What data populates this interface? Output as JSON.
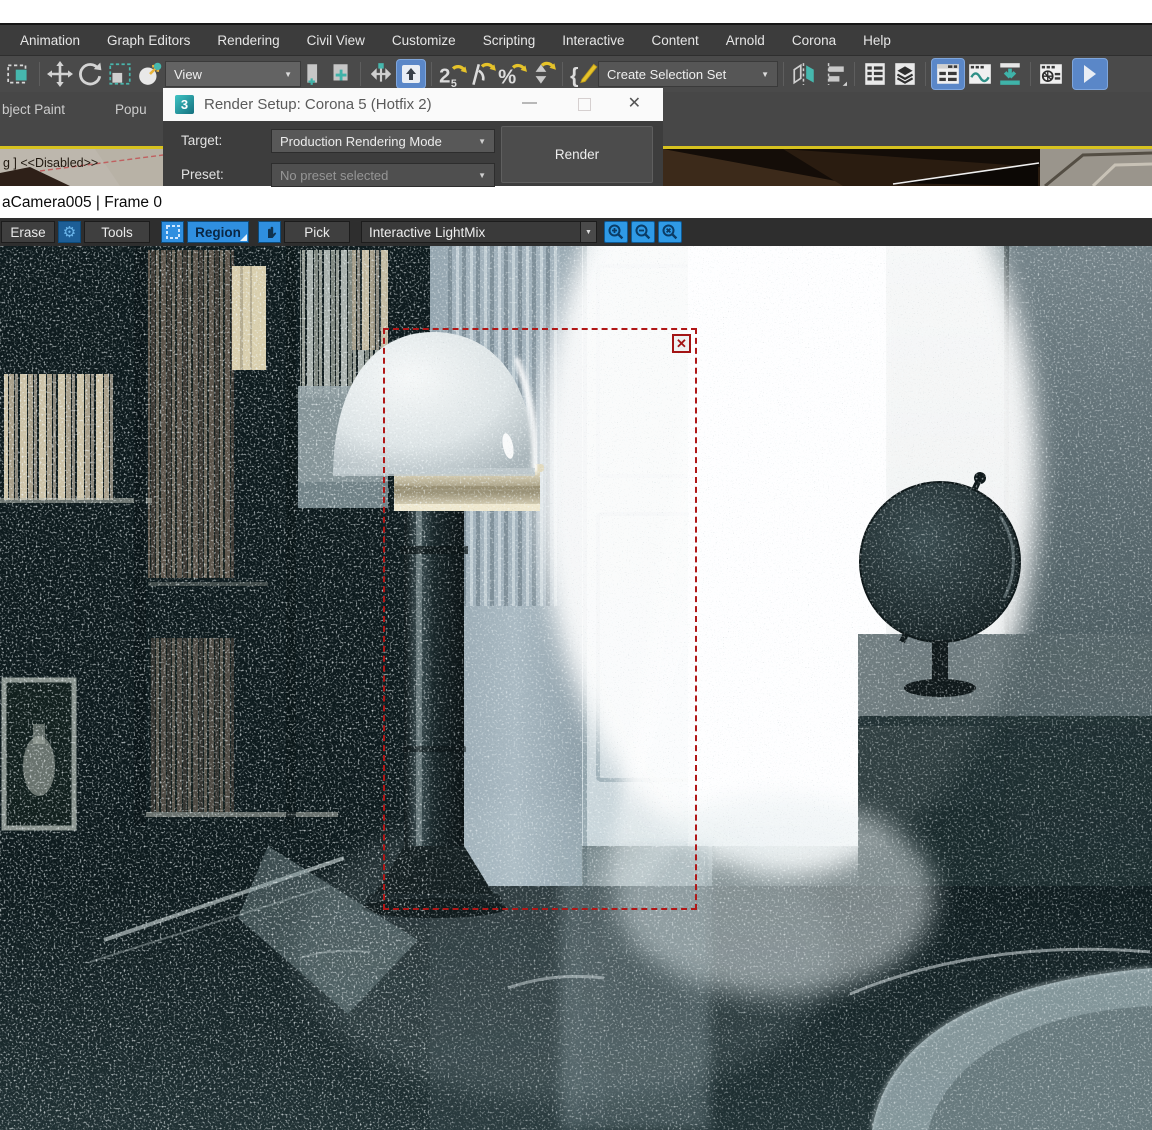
{
  "menubar": {
    "items": [
      "Animation",
      "Graph Editors",
      "Rendering",
      "Civil View",
      "Customize",
      "Scripting",
      "Interactive",
      "Content",
      "Arnold",
      "Corona",
      "Help"
    ]
  },
  "main_toolbar": {
    "view_dropdown": "View",
    "selection_set_dropdown": "Create Selection Set"
  },
  "ribbon": {
    "tab_object_paint": "bject Paint",
    "tab_populate": "Popu"
  },
  "viewport_strip": {
    "label": "g ]  <<Disabled>>"
  },
  "render_setup_dialog": {
    "title": "Render Setup: Corona 5 (Hotfix 2)",
    "logo": "3",
    "target_label": "Target:",
    "target_value": "Production Rendering Mode",
    "preset_label": "Preset:",
    "preset_value": "No preset selected",
    "render_button": "Render"
  },
  "vfb": {
    "camera_label": "aCamera005 | Frame 0",
    "erase": "Erase",
    "tools": "Tools",
    "region": "Region",
    "pick": "Pick",
    "lightmix_dropdown": "Interactive LightMix"
  },
  "glyphs": {
    "dropdown_arrow": "▼",
    "gear": "⚙",
    "minimize": "—",
    "close": "✕",
    "region_close": "✕",
    "zoom_in": "+",
    "zoom_out": "−",
    "zoom_reset": "×",
    "snap25_main": "2",
    "snap25_sub": "5",
    "percent": "%",
    "brace": "{"
  },
  "colors": {
    "accent_teal": "#46b8ae",
    "accent_blue": "#5a87c8",
    "vfb_blue": "#2f8fe0",
    "region_red": "#b01818",
    "viewport_active_border": "#d7c21f"
  }
}
